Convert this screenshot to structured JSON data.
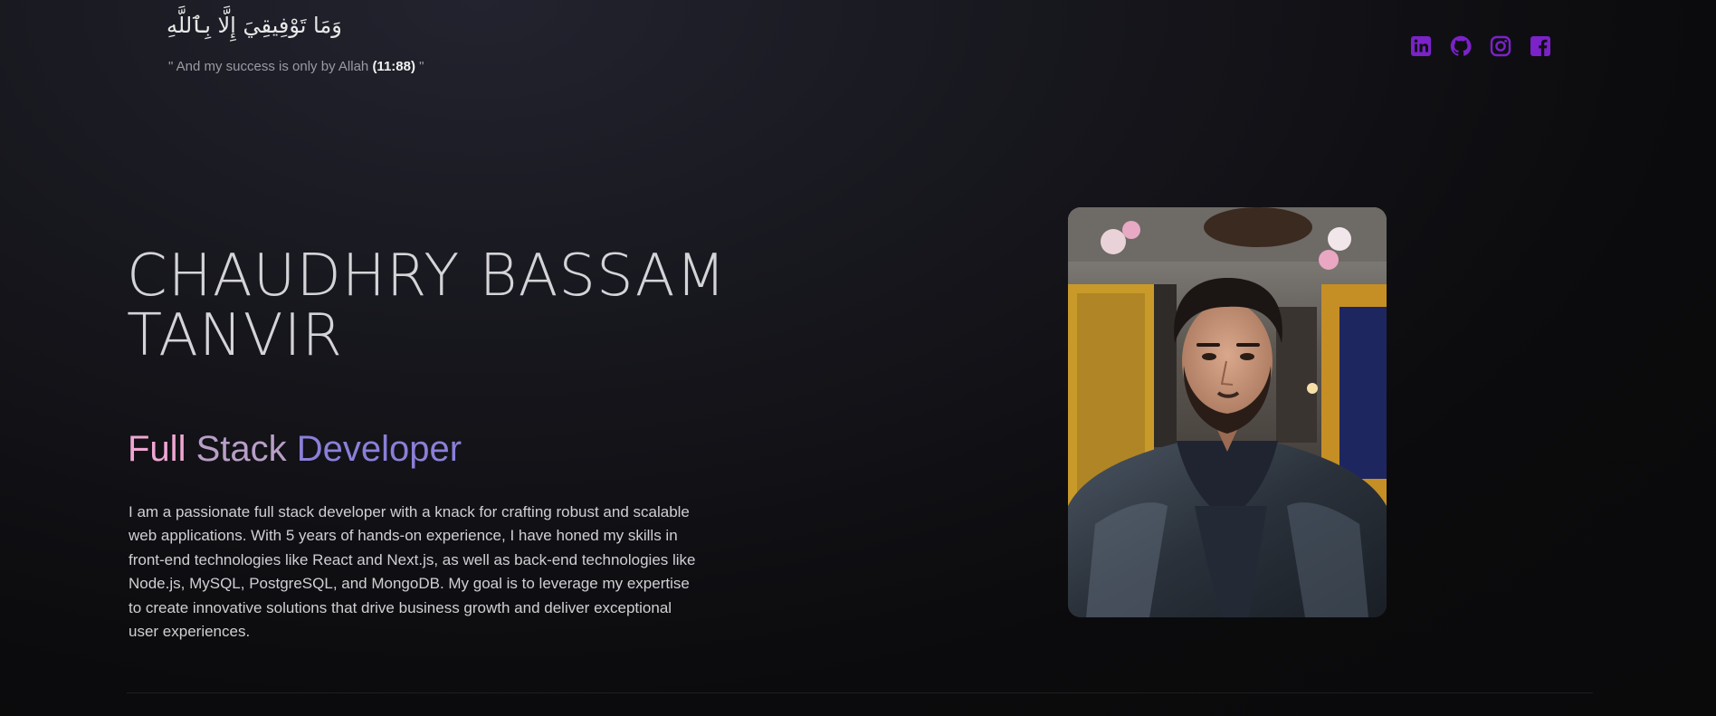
{
  "header": {
    "verse_arabic": "وَمَا تَوْفِيقِيَ إِلَّا بِٱللَّهِ",
    "verse_translation_prefix": "\" And my success is only by Allah ",
    "verse_reference": "(11:88)",
    "verse_translation_suffix": " \""
  },
  "social": [
    {
      "name": "linkedin-icon",
      "color": "#7b22c9"
    },
    {
      "name": "github-icon",
      "color": "#7b22c9"
    },
    {
      "name": "instagram-icon",
      "color": "#7b22c9"
    },
    {
      "name": "facebook-icon",
      "color": "#7b22c9"
    }
  ],
  "hero": {
    "name_line1": "CHAUDHRY BASSAM",
    "name_line2": "TANVIR",
    "role_word1": "Full",
    "role_word2": "Stack",
    "role_word3": "Developer",
    "bio": "I am a passionate full stack developer with a knack for crafting robust and scalable web applications. With 5 years of hands-on experience, I have honed my skills in front-end technologies like React and Next.js, as well as back-end technologies like Node.js, MySQL, PostgreSQL, and MongoDB. My goal is to leverage my expertise to create innovative solutions that drive business growth and deliver exceptional user experiences."
  },
  "colors": {
    "background": "#0b0b0d",
    "accent": "#7b22c9",
    "role_gradient": [
      "#f0a6d3",
      "#b89fc6",
      "#8a7fd8"
    ]
  }
}
